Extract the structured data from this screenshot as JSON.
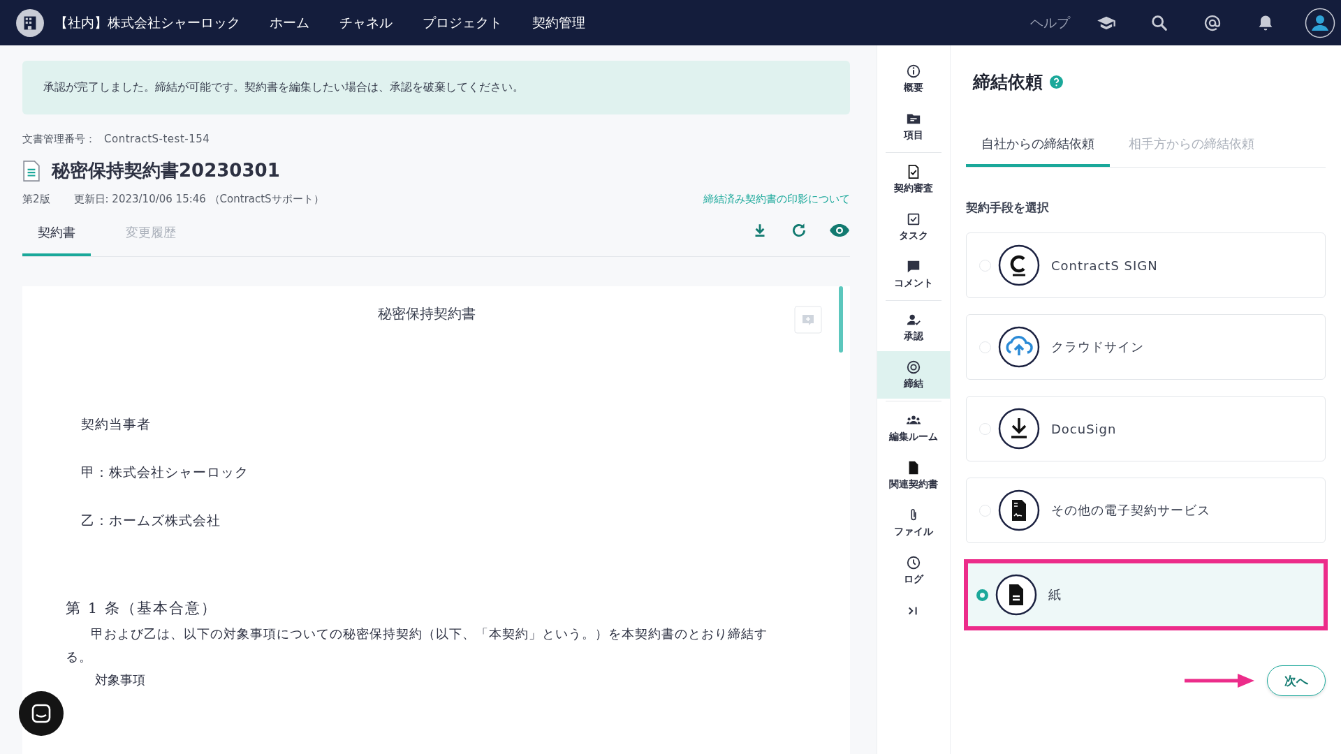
{
  "topbar": {
    "org": "【社内】株式会社シャーロック",
    "nav": [
      {
        "label": "ホーム"
      },
      {
        "label": "チャネル"
      },
      {
        "label": "プロジェクト"
      },
      {
        "label": "契約管理"
      }
    ],
    "help": "ヘルプ"
  },
  "alert": "承認が完了しました。締結が可能です。契約書を編集したい場合は、承認を破棄してください。",
  "doc_number": {
    "label": "文書管理番号：",
    "value": "ContractS-test-154"
  },
  "title": "秘密保持契約書20230301",
  "meta": {
    "version": "第2版",
    "updated": "更新日: 2023/10/06 15:46 （ContractSサポート）",
    "link": "締結済み契約書の印影について"
  },
  "tabs": [
    {
      "label": "契約書",
      "selected": true
    },
    {
      "label": "変更履歴",
      "selected": false
    }
  ],
  "document": {
    "heading": "秘密保持契約書",
    "parties": [
      "契約当事者",
      "甲：株式会社シャーロック",
      "乙：ホームズ株式会社"
    ],
    "article": "第 1 条（基本合意）",
    "body": "甲および乙は、以下の対象事項についての秘密保持契約（以下、「本契約」という。）を本契約書のとおり締結する。",
    "item": "対象事項"
  },
  "sidebar": [
    {
      "group": [
        {
          "label": "概要",
          "selected": false
        },
        {
          "label": "項目",
          "selected": false
        }
      ]
    },
    {
      "group": [
        {
          "label": "契約審査",
          "selected": false
        },
        {
          "label": "タスク",
          "selected": false
        },
        {
          "label": "コメント",
          "selected": false
        }
      ]
    },
    {
      "group": [
        {
          "label": "承認",
          "selected": false
        },
        {
          "label": "締結",
          "selected": true
        }
      ]
    },
    {
      "group": [
        {
          "label": "編集ルーム",
          "selected": false
        },
        {
          "label": "関連契約書",
          "selected": false
        },
        {
          "label": "ファイル",
          "selected": false
        },
        {
          "label": "ログ",
          "selected": false
        }
      ]
    }
  ],
  "panel": {
    "title": "締結依頼",
    "tabs": [
      {
        "label": "自社からの締結依頼",
        "selected": true
      },
      {
        "label": "相手方からの締結依頼",
        "selected": false
      }
    ],
    "section": "契約手段を選択",
    "options": [
      {
        "label": "ContractS SIGN",
        "selected": false,
        "highlighted": false
      },
      {
        "label": "クラウドサイン",
        "selected": false,
        "highlighted": false
      },
      {
        "label": "DocuSign",
        "selected": false,
        "highlighted": false
      },
      {
        "label": "その他の電子契約サービス",
        "selected": false,
        "highlighted": false
      },
      {
        "label": "紙",
        "selected": true,
        "highlighted": true
      }
    ],
    "next": "次へ"
  }
}
